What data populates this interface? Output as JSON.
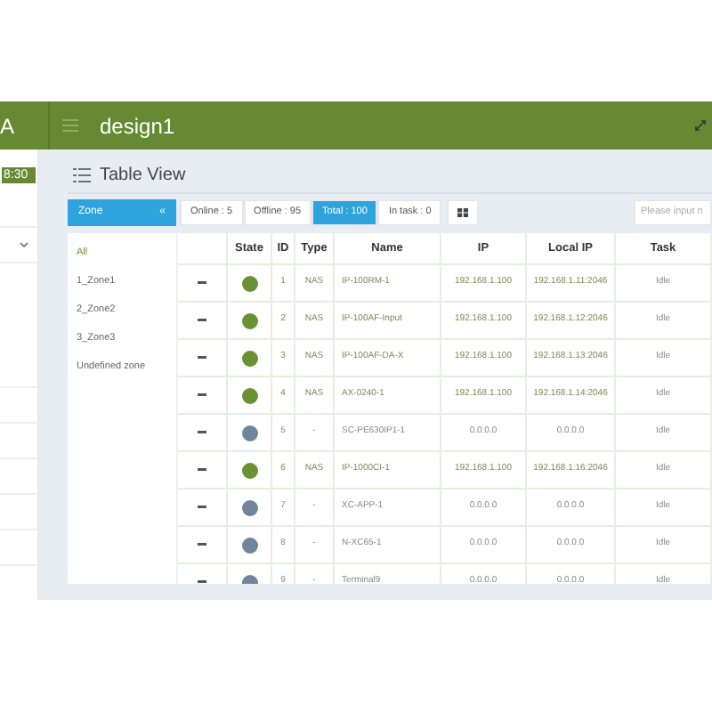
{
  "sidebar": {
    "title": "A",
    "time": "8:30",
    "expanded": true
  },
  "header": {
    "title": "design1"
  },
  "page_title": "Table View",
  "zone_button": {
    "label": "Zone",
    "icon_text": "«"
  },
  "filters": [
    {
      "label": "Online : 5",
      "selected": false
    },
    {
      "label": "Offline : 95",
      "selected": false
    },
    {
      "label": "Total : 100",
      "selected": true
    },
    {
      "label": "In task : 0",
      "selected": false
    }
  ],
  "search": {
    "placeholder": "Please input n"
  },
  "zones": [
    {
      "label": "All",
      "selected": true
    },
    {
      "label": "1_Zone1",
      "selected": false
    },
    {
      "label": "2_Zone2",
      "selected": false
    },
    {
      "label": "3_Zone3",
      "selected": false
    },
    {
      "label": "Undefined zone",
      "selected": false
    }
  ],
  "table": {
    "columns": [
      "State",
      "ID",
      "Type",
      "Name",
      "IP",
      "Local IP",
      "Task"
    ],
    "rows": [
      {
        "color": "#6a9232",
        "id": "1",
        "type": "NAS",
        "name": "IP-100RM-1",
        "ip": "192.168.1.100",
        "local_ip": "192.168.1.11:2046",
        "task": "Idle"
      },
      {
        "color": "#6a9232",
        "id": "2",
        "type": "NAS",
        "name": "IP-100AF-Input",
        "ip": "192.168.1.100",
        "local_ip": "192.168.1.12:2046",
        "task": "Idle"
      },
      {
        "color": "#6a9232",
        "id": "3",
        "type": "NAS",
        "name": "IP-100AF-DA-X",
        "ip": "192.168.1.100",
        "local_ip": "192.168.1.13:2046",
        "task": "Idle"
      },
      {
        "color": "#6a9232",
        "id": "4",
        "type": "NAS",
        "name": "AX-0240-1",
        "ip": "192.168.1.100",
        "local_ip": "192.168.1.14:2046",
        "task": "Idle"
      },
      {
        "color": "#71849e",
        "id": "5",
        "type": "-",
        "name": "SC-PE630IP1-1",
        "ip": "0.0.0.0",
        "local_ip": "0.0.0.0",
        "task": "Idle"
      },
      {
        "color": "#6a9232",
        "id": "6",
        "type": "NAS",
        "name": "IP-1000CI-1",
        "ip": "192.168.1.100",
        "local_ip": "192.168.1.16:2046",
        "task": "Idle"
      },
      {
        "color": "#71849e",
        "id": "7",
        "type": "-",
        "name": "XC-APP-1",
        "ip": "0.0.0.0",
        "local_ip": "0.0.0.0",
        "task": "Idle"
      },
      {
        "color": "#71849e",
        "id": "8",
        "type": "-",
        "name": "N-XC65-1",
        "ip": "0.0.0.0",
        "local_ip": "0.0.0.0",
        "task": "Idle"
      },
      {
        "color": "#71849e",
        "id": "9",
        "type": "-",
        "name": "Terminal9",
        "ip": "0.0.0.0",
        "local_ip": "0.0.0.0",
        "task": "Idle"
      }
    ]
  }
}
